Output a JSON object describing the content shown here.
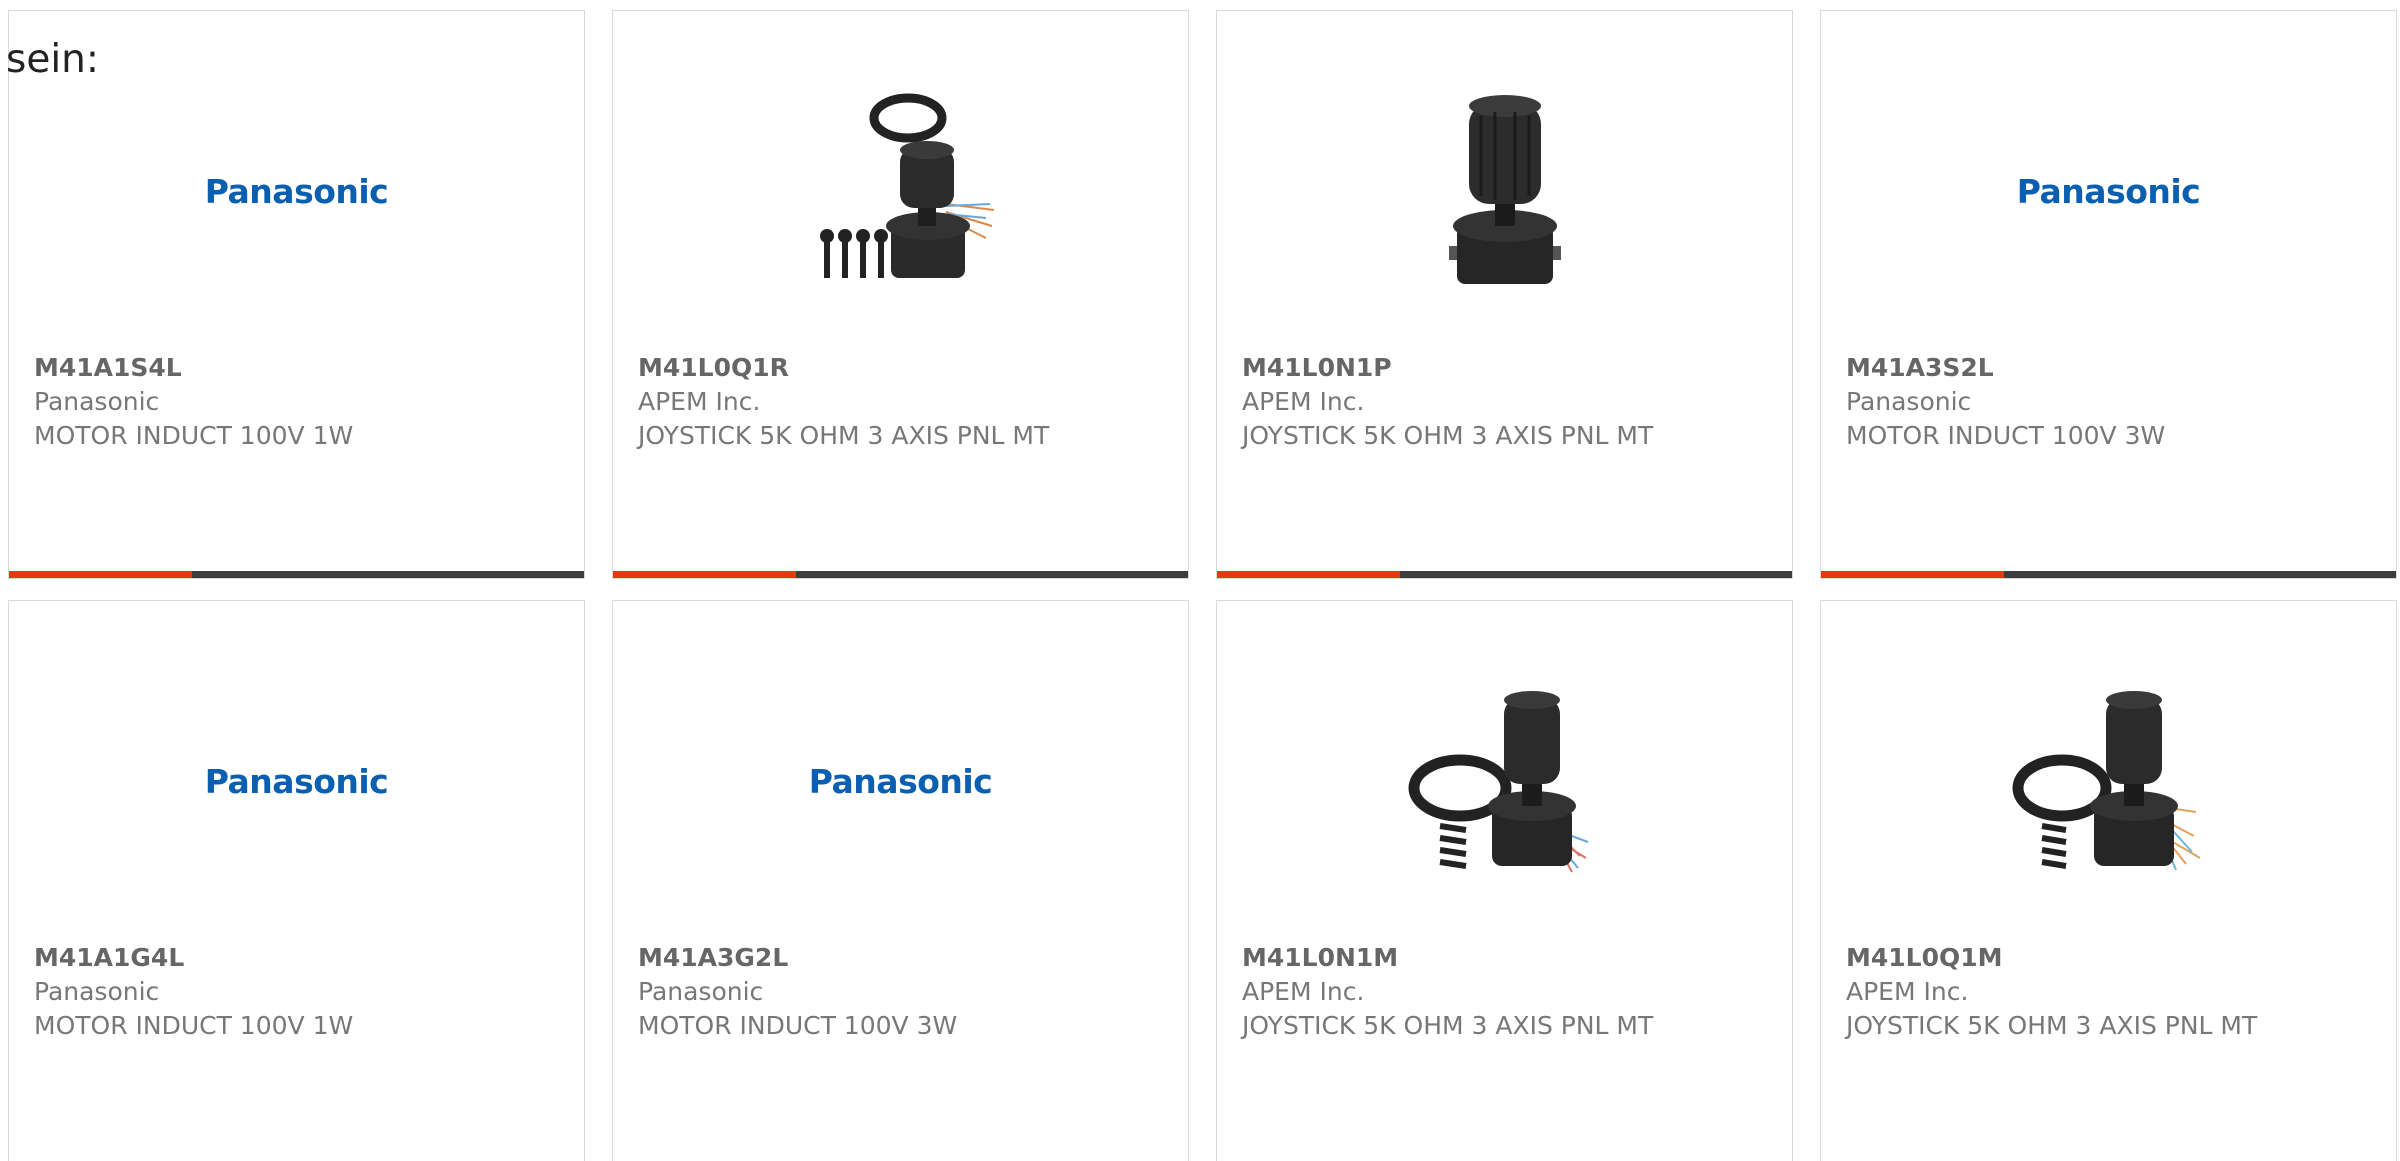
{
  "intro_text": "sein:",
  "products": [
    {
      "part": "M41A1S4L",
      "maker": "Panasonic",
      "description": "MOTOR INDUCT 100V 1W",
      "image": "panasonic-logo",
      "logo_text": "Panasonic"
    },
    {
      "part": "M41L0Q1R",
      "maker": "APEM Inc.",
      "description": "JOYSTICK 5K OHM 3 AXIS PNL MT",
      "image": "joystick-kit-icon",
      "logo_text": ""
    },
    {
      "part": "M41L0N1P",
      "maker": "APEM Inc.",
      "description": "JOYSTICK 5K OHM 3 AXIS PNL MT",
      "image": "joystick-icon",
      "logo_text": ""
    },
    {
      "part": "M41A3S2L",
      "maker": "Panasonic",
      "description": "MOTOR INDUCT 100V 3W",
      "image": "panasonic-logo",
      "logo_text": "Panasonic"
    },
    {
      "part": "M41A1G4L",
      "maker": "Panasonic",
      "description": "MOTOR INDUCT 100V 1W",
      "image": "panasonic-logo",
      "logo_text": "Panasonic"
    },
    {
      "part": "M41A3G2L",
      "maker": "Panasonic",
      "description": "MOTOR INDUCT 100V 3W",
      "image": "panasonic-logo",
      "logo_text": "Panasonic"
    },
    {
      "part": "M41L0N1M",
      "maker": "APEM Inc.",
      "description": "JOYSTICK 5K OHM 3 AXIS PNL MT",
      "image": "joystick-kit-icon",
      "logo_text": ""
    },
    {
      "part": "M41L0Q1M",
      "maker": "APEM Inc.",
      "description": "JOYSTICK 5K OHM 3 AXIS PNL MT",
      "image": "joystick-kit-icon",
      "logo_text": ""
    }
  ],
  "colors": {
    "accent": "#e8380d",
    "bar": "#3d3d3d",
    "brand_blue": "#0a5fb0",
    "text_gray": "#777777"
  }
}
